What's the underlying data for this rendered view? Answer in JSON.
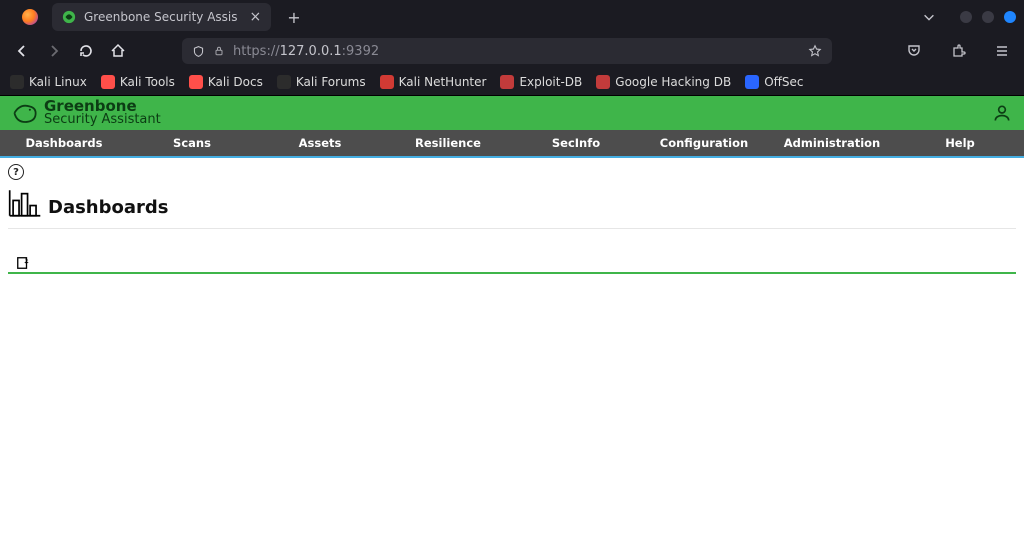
{
  "browser": {
    "tab_title": "Greenbone Security Assis",
    "url_prefix": "https://",
    "url_main": "127.0.0.1",
    "url_suffix": ":9392"
  },
  "bookmarks": [
    {
      "label": "Kali Linux",
      "bg": "#2c2c2c"
    },
    {
      "label": "Kali Tools",
      "bg": "#ff4f4a"
    },
    {
      "label": "Kali Docs",
      "bg": "#ff4f4a"
    },
    {
      "label": "Kali Forums",
      "bg": "#2c2c2c"
    },
    {
      "label": "Kali NetHunter",
      "bg": "#d13a34"
    },
    {
      "label": "Exploit-DB",
      "bg": "#c23b3b"
    },
    {
      "label": "Google Hacking DB",
      "bg": "#c23b3b"
    },
    {
      "label": "OffSec",
      "bg": "#2a66ff"
    }
  ],
  "gb": {
    "brand_top": "Greenbone",
    "brand_bottom": "Security Assistant",
    "menu": [
      "Dashboards",
      "Scans",
      "Assets",
      "Resilience",
      "SecInfo",
      "Configuration",
      "Administration",
      "Help"
    ],
    "page_title": "Dashboards"
  }
}
